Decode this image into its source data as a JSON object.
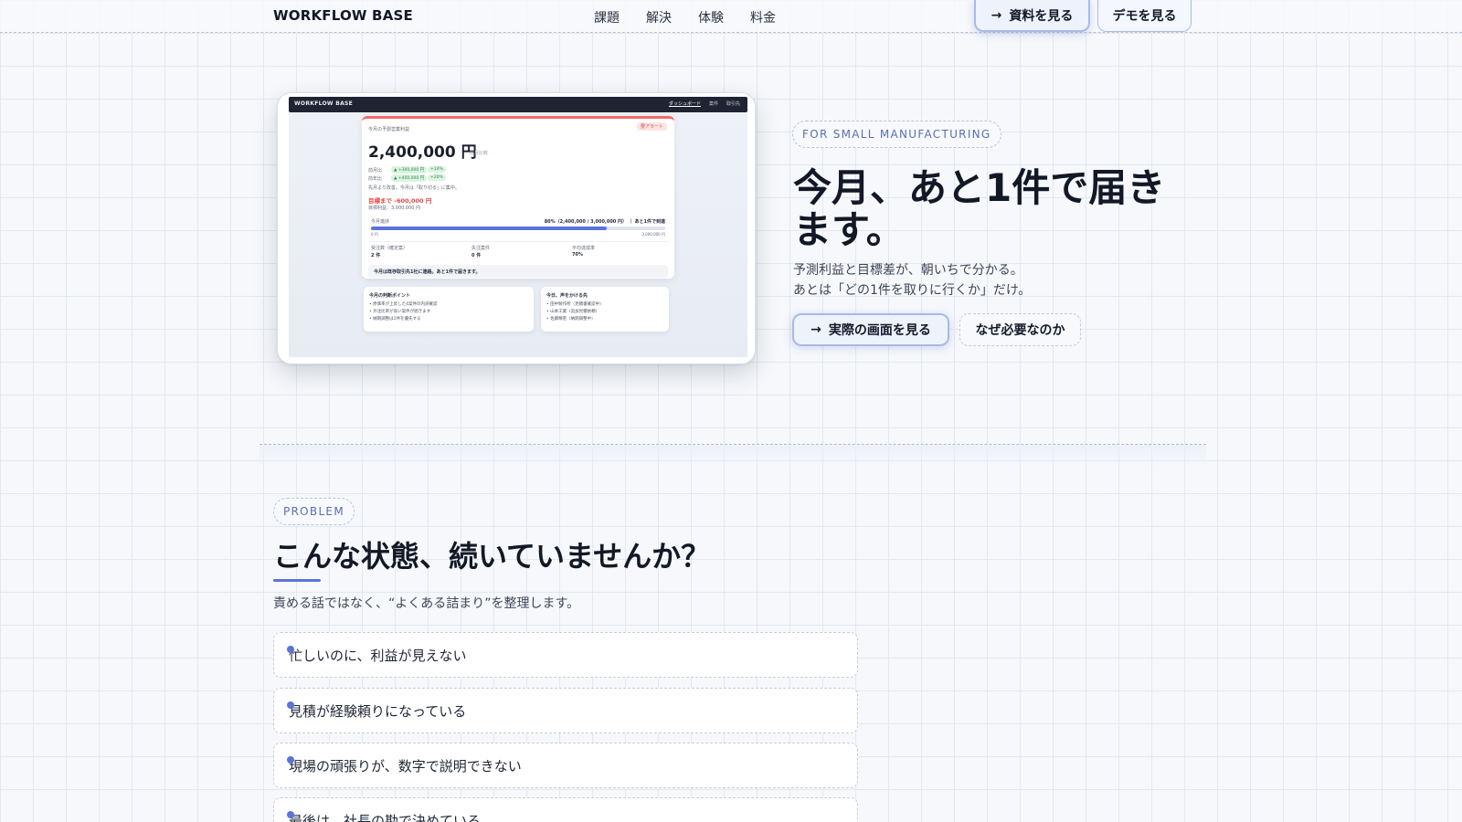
{
  "nav": {
    "brand": "WORKFLOW BASE",
    "links": [
      "課題",
      "解決",
      "体験",
      "料金"
    ],
    "cta_primary": "資料を見る",
    "cta_secondary": "デモを見る"
  },
  "mockup": {
    "brand": "WORKFLOW BASE",
    "tabs": [
      "ダッシュボード",
      "案件",
      "取引先"
    ],
    "card_label": "今月の予測営業利益",
    "badge": "要アラート",
    "amount": "2,400,000 円",
    "amount_note": "前月比較",
    "row1_label": "前月比",
    "row1_chip1": "▲ +300,000 円",
    "row1_chip2": "+14%",
    "row2_label": "前年比",
    "row2_chip1": "▲ +400,000 円",
    "row2_chip2": "+20%",
    "comment": "先月より改善。今月は「取り切る」に集中。",
    "gap": "目標まで -600,000 円",
    "target": "目標利益：3,000,000 円",
    "progress_label": "今月進捗",
    "progress_value": "80%（2,400,000 / 3,000,000 円） ｜ あと1件で到達",
    "progress_fraction": 0.8,
    "progress_left": "0 円",
    "progress_right": "3,000,000 円",
    "kpis": [
      {
        "label": "受注数（確定案）",
        "value": "2 件"
      },
      {
        "label": "失注案件",
        "value": "0 件"
      },
      {
        "label": "平均達成率",
        "value": "70%"
      }
    ],
    "note": "今月は既存取引先1社に連絡。あと1件で届きます。",
    "sub_left_title": "今月の判断ポイント",
    "sub_left_items": [
      "原価率が上昇した4案件の内訳確認",
      "外注比率が高い案件が続きます",
      "納期調整は1件を優先する"
    ],
    "sub_right_title": "今日、声をかける先",
    "sub_right_items": [
      "田中製作所（見積書確認中）",
      "山本工業（追加見積依頼）",
      "佐藤精密（納期調整中）"
    ]
  },
  "hero": {
    "pill": "FOR SMALL MANUFACTURING",
    "title": "今月、あと1件で届きます。",
    "sub_line1": "予測利益と目標差が、朝いちで分かる。",
    "sub_line2": "あとは「どの1件を取りに行くか」だけ。",
    "cta_primary": "実際の画面を見る",
    "cta_secondary": "なぜ必要なのか"
  },
  "problem": {
    "pill": "PROBLEM",
    "title": "こんな状態、続いていませんか？",
    "subtitle": "責める話ではなく、“よくある詰まり”を整理します。",
    "items": [
      "忙しいのに、利益が見えない",
      "見積が経験頼りになっている",
      "現場の頑張りが、数字で説明できない",
      "最後は、社長の勘で決めている"
    ]
  }
}
